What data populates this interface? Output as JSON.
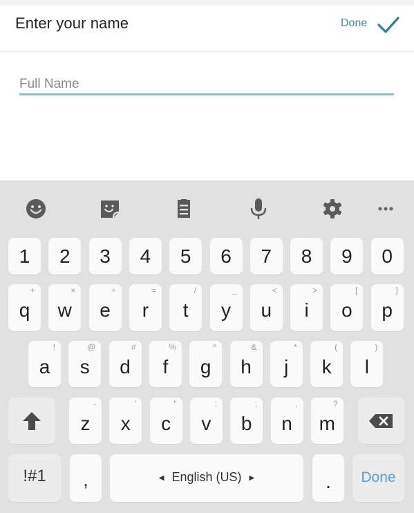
{
  "header": {
    "title": "Enter your name",
    "done_label": "Done",
    "accent_color": "#3f8a9a",
    "check_icon": "checkmark-icon"
  },
  "form": {
    "name_field": {
      "value": "",
      "placeholder": "Full Name",
      "underline_color": "#7cc4cf"
    }
  },
  "keyboard": {
    "toolbar": [
      {
        "name": "emoji-icon",
        "label": "Emoji"
      },
      {
        "name": "sticker-icon",
        "label": "Stickers"
      },
      {
        "name": "clipboard-icon",
        "label": "Clipboard"
      },
      {
        "name": "microphone-icon",
        "label": "Voice input"
      },
      {
        "name": "settings-gear-icon",
        "label": "Settings"
      },
      {
        "name": "more-options-icon",
        "label": "More"
      }
    ],
    "number_row": [
      "1",
      "2",
      "3",
      "4",
      "5",
      "6",
      "7",
      "8",
      "9",
      "0"
    ],
    "row1": [
      {
        "key": "q",
        "hint": "+"
      },
      {
        "key": "w",
        "hint": "×"
      },
      {
        "key": "e",
        "hint": "÷"
      },
      {
        "key": "r",
        "hint": "="
      },
      {
        "key": "t",
        "hint": "/"
      },
      {
        "key": "y",
        "hint": "_"
      },
      {
        "key": "u",
        "hint": "<"
      },
      {
        "key": "i",
        "hint": ">"
      },
      {
        "key": "o",
        "hint": "["
      },
      {
        "key": "p",
        "hint": "]"
      }
    ],
    "row2": [
      {
        "key": "a",
        "hint": "!"
      },
      {
        "key": "s",
        "hint": "@"
      },
      {
        "key": "d",
        "hint": "#"
      },
      {
        "key": "f",
        "hint": "%"
      },
      {
        "key": "g",
        "hint": "^"
      },
      {
        "key": "h",
        "hint": "&"
      },
      {
        "key": "j",
        "hint": "*"
      },
      {
        "key": "k",
        "hint": "("
      },
      {
        "key": "l",
        "hint": ")"
      }
    ],
    "row3": [
      {
        "key": "z",
        "hint": "-"
      },
      {
        "key": "x",
        "hint": "'"
      },
      {
        "key": "c",
        "hint": "\""
      },
      {
        "key": "v",
        "hint": ":"
      },
      {
        "key": "b",
        "hint": ";"
      },
      {
        "key": "n",
        "hint": ","
      },
      {
        "key": "m",
        "hint": "?"
      }
    ],
    "shift_icon": "shift-arrow-icon",
    "backspace_icon": "backspace-icon",
    "symbols_label": "!#1",
    "comma_label": ",",
    "space_label": "English (US)",
    "period_label": ".",
    "done_label": "Done",
    "done_color": "#5b9bd5"
  }
}
